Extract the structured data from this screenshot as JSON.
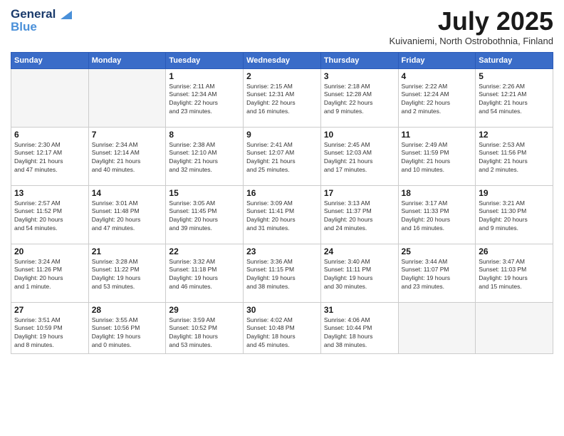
{
  "header": {
    "logo_line1": "General",
    "logo_line2": "Blue",
    "month": "July 2025",
    "location": "Kuivaniemi, North Ostrobothnia, Finland"
  },
  "weekdays": [
    "Sunday",
    "Monday",
    "Tuesday",
    "Wednesday",
    "Thursday",
    "Friday",
    "Saturday"
  ],
  "weeks": [
    [
      {
        "day": "",
        "info": ""
      },
      {
        "day": "",
        "info": ""
      },
      {
        "day": "1",
        "info": "Sunrise: 2:11 AM\nSunset: 12:34 AM\nDaylight: 22 hours\nand 23 minutes."
      },
      {
        "day": "2",
        "info": "Sunrise: 2:15 AM\nSunset: 12:31 AM\nDaylight: 22 hours\nand 16 minutes."
      },
      {
        "day": "3",
        "info": "Sunrise: 2:18 AM\nSunset: 12:28 AM\nDaylight: 22 hours\nand 9 minutes."
      },
      {
        "day": "4",
        "info": "Sunrise: 2:22 AM\nSunset: 12:24 AM\nDaylight: 22 hours\nand 2 minutes."
      },
      {
        "day": "5",
        "info": "Sunrise: 2:26 AM\nSunset: 12:21 AM\nDaylight: 21 hours\nand 54 minutes."
      }
    ],
    [
      {
        "day": "6",
        "info": "Sunrise: 2:30 AM\nSunset: 12:17 AM\nDaylight: 21 hours\nand 47 minutes."
      },
      {
        "day": "7",
        "info": "Sunrise: 2:34 AM\nSunset: 12:14 AM\nDaylight: 21 hours\nand 40 minutes."
      },
      {
        "day": "8",
        "info": "Sunrise: 2:38 AM\nSunset: 12:10 AM\nDaylight: 21 hours\nand 32 minutes."
      },
      {
        "day": "9",
        "info": "Sunrise: 2:41 AM\nSunset: 12:07 AM\nDaylight: 21 hours\nand 25 minutes."
      },
      {
        "day": "10",
        "info": "Sunrise: 2:45 AM\nSunset: 12:03 AM\nDaylight: 21 hours\nand 17 minutes."
      },
      {
        "day": "11",
        "info": "Sunrise: 2:49 AM\nSunset: 11:59 PM\nDaylight: 21 hours\nand 10 minutes."
      },
      {
        "day": "12",
        "info": "Sunrise: 2:53 AM\nSunset: 11:56 PM\nDaylight: 21 hours\nand 2 minutes."
      }
    ],
    [
      {
        "day": "13",
        "info": "Sunrise: 2:57 AM\nSunset: 11:52 PM\nDaylight: 20 hours\nand 54 minutes."
      },
      {
        "day": "14",
        "info": "Sunrise: 3:01 AM\nSunset: 11:48 PM\nDaylight: 20 hours\nand 47 minutes."
      },
      {
        "day": "15",
        "info": "Sunrise: 3:05 AM\nSunset: 11:45 PM\nDaylight: 20 hours\nand 39 minutes."
      },
      {
        "day": "16",
        "info": "Sunrise: 3:09 AM\nSunset: 11:41 PM\nDaylight: 20 hours\nand 31 minutes."
      },
      {
        "day": "17",
        "info": "Sunrise: 3:13 AM\nSunset: 11:37 PM\nDaylight: 20 hours\nand 24 minutes."
      },
      {
        "day": "18",
        "info": "Sunrise: 3:17 AM\nSunset: 11:33 PM\nDaylight: 20 hours\nand 16 minutes."
      },
      {
        "day": "19",
        "info": "Sunrise: 3:21 AM\nSunset: 11:30 PM\nDaylight: 20 hours\nand 9 minutes."
      }
    ],
    [
      {
        "day": "20",
        "info": "Sunrise: 3:24 AM\nSunset: 11:26 PM\nDaylight: 20 hours\nand 1 minute."
      },
      {
        "day": "21",
        "info": "Sunrise: 3:28 AM\nSunset: 11:22 PM\nDaylight: 19 hours\nand 53 minutes."
      },
      {
        "day": "22",
        "info": "Sunrise: 3:32 AM\nSunset: 11:18 PM\nDaylight: 19 hours\nand 46 minutes."
      },
      {
        "day": "23",
        "info": "Sunrise: 3:36 AM\nSunset: 11:15 PM\nDaylight: 19 hours\nand 38 minutes."
      },
      {
        "day": "24",
        "info": "Sunrise: 3:40 AM\nSunset: 11:11 PM\nDaylight: 19 hours\nand 30 minutes."
      },
      {
        "day": "25",
        "info": "Sunrise: 3:44 AM\nSunset: 11:07 PM\nDaylight: 19 hours\nand 23 minutes."
      },
      {
        "day": "26",
        "info": "Sunrise: 3:47 AM\nSunset: 11:03 PM\nDaylight: 19 hours\nand 15 minutes."
      }
    ],
    [
      {
        "day": "27",
        "info": "Sunrise: 3:51 AM\nSunset: 10:59 PM\nDaylight: 19 hours\nand 8 minutes."
      },
      {
        "day": "28",
        "info": "Sunrise: 3:55 AM\nSunset: 10:56 PM\nDaylight: 19 hours\nand 0 minutes."
      },
      {
        "day": "29",
        "info": "Sunrise: 3:59 AM\nSunset: 10:52 PM\nDaylight: 18 hours\nand 53 minutes."
      },
      {
        "day": "30",
        "info": "Sunrise: 4:02 AM\nSunset: 10:48 PM\nDaylight: 18 hours\nand 45 minutes."
      },
      {
        "day": "31",
        "info": "Sunrise: 4:06 AM\nSunset: 10:44 PM\nDaylight: 18 hours\nand 38 minutes."
      },
      {
        "day": "",
        "info": ""
      },
      {
        "day": "",
        "info": ""
      }
    ]
  ]
}
